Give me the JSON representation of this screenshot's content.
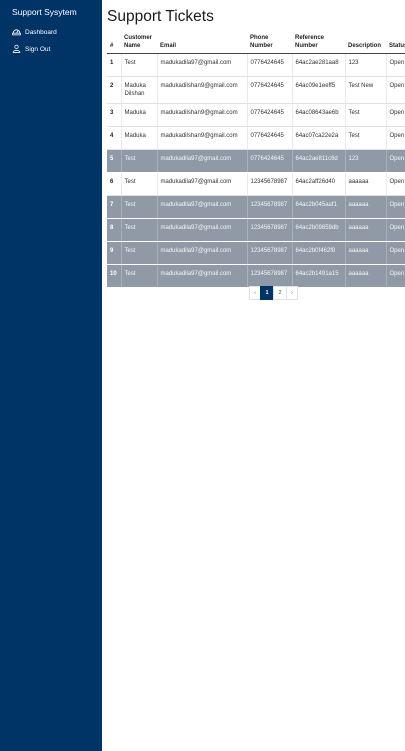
{
  "app": {
    "brand": "Support Sysytem"
  },
  "sidebar": {
    "items": [
      {
        "label": "Dashboard",
        "icon": "dashboard-icon"
      },
      {
        "label": "Sign Out",
        "icon": "user-icon"
      }
    ]
  },
  "page": {
    "title": "Support Tickets"
  },
  "table": {
    "headers": [
      "#",
      "Customer Name",
      "Email",
      "Phone Number",
      "Reference Number",
      "Description",
      "Status"
    ],
    "rows": [
      {
        "num": "1",
        "customer": "Test",
        "email": "madukadila97@gmail.com",
        "phone": "0776424645",
        "ref": "64ac2ae281aa8",
        "desc": "123",
        "status": "Open",
        "highlight": false
      },
      {
        "num": "2",
        "customer": "Maduka Dilshan",
        "email": "madukadilshan9@gmail.com",
        "phone": "0776424645",
        "ref": "64ac09e1eeff5",
        "desc": "Test New",
        "status": "Open",
        "highlight": false
      },
      {
        "num": "3",
        "customer": "Maduka",
        "email": "madukadilshan9@gmail.com",
        "phone": "0776424645",
        "ref": "64ac08643ae6b",
        "desc": "Test",
        "status": "Open",
        "highlight": false
      },
      {
        "num": "4",
        "customer": "Maduka",
        "email": "madukadilshan9@gmail.com",
        "phone": "0776424645",
        "ref": "64ac07ca22e2a",
        "desc": "Test",
        "status": "Open",
        "highlight": false
      },
      {
        "num": "5",
        "customer": "Test",
        "email": "madukadila97@gmail.com",
        "phone": "0776424645",
        "ref": "64ac2ae811c6d",
        "desc": "123",
        "status": "Open",
        "highlight": true
      },
      {
        "num": "6",
        "customer": "Test",
        "email": "madukadila97@gmail.com",
        "phone": "12345678987",
        "ref": "64ac2aff26d40",
        "desc": "aaaaaa",
        "status": "Open",
        "highlight": false
      },
      {
        "num": "7",
        "customer": "Test",
        "email": "madukadila97@gmail.com",
        "phone": "12345678987",
        "ref": "64ac2b045aaf1",
        "desc": "aaaaaa",
        "status": "Open",
        "highlight": true
      },
      {
        "num": "8",
        "customer": "Test",
        "email": "madukadila97@gmail.com",
        "phone": "12345678987",
        "ref": "64ac2b09859db",
        "desc": "aaaaaa",
        "status": "Open",
        "highlight": true
      },
      {
        "num": "9",
        "customer": "Test",
        "email": "madukadila97@gmail.com",
        "phone": "12345678987",
        "ref": "64ac2b0f462f8",
        "desc": "aaaaaa",
        "status": "Open",
        "highlight": true
      },
      {
        "num": "10",
        "customer": "Test",
        "email": "madukadila97@gmail.com",
        "phone": "12345678987",
        "ref": "64ac2b1491a15",
        "desc": "aaaaaa",
        "status": "Open",
        "highlight": true
      }
    ]
  },
  "pagination": {
    "prev": "‹",
    "pages": [
      "1",
      "2"
    ],
    "active": "1",
    "next": "›"
  },
  "colors": {
    "sidebar": "#003366",
    "highlight_row": "#8f9aa6",
    "active_page": "#003366"
  }
}
